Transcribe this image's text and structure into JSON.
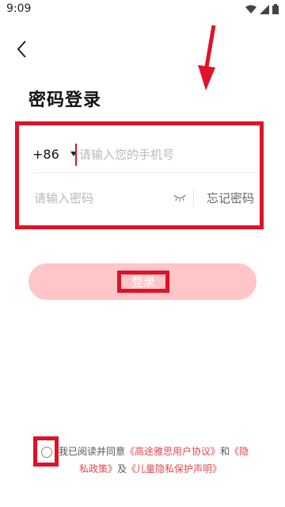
{
  "status_bar": {
    "time": "9:09"
  },
  "header": {
    "title": "密码登录"
  },
  "form": {
    "country_code": "+86",
    "phone_placeholder": "请输入您的手机号",
    "password_placeholder": "请输入密码",
    "forgot_password": "忘记密码"
  },
  "login_button": {
    "label": "登录"
  },
  "agreement": {
    "prefix": "我已阅读并同意",
    "terms_link": "《高途雅思用户协议》",
    "and": "和",
    "privacy_link_part1": "《隐",
    "privacy_link_part2": "私政策》",
    "and2": "及",
    "children_link": "《儿童隐私保护声明》"
  },
  "colors": {
    "accent": "#e01227",
    "button_disabled": "#ffc6c8",
    "link": "#e5484d"
  }
}
